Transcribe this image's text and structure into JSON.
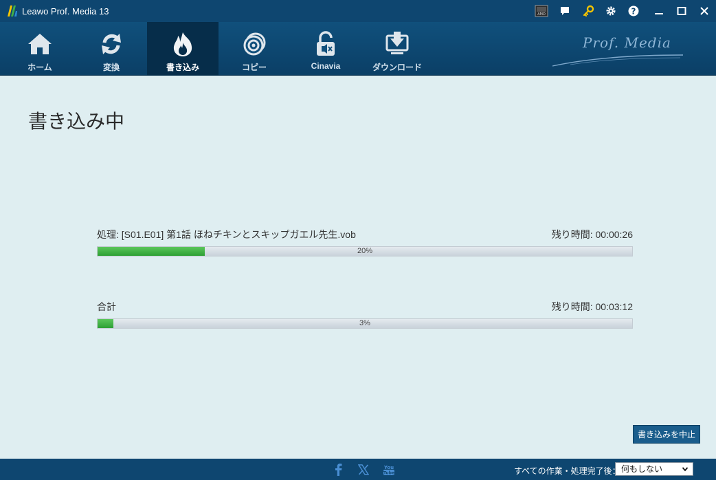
{
  "window": {
    "title": "Leawo Prof. Media 13"
  },
  "nav": {
    "items": [
      {
        "label": "ホーム",
        "icon": "home-icon"
      },
      {
        "label": "変換",
        "icon": "convert-icon"
      },
      {
        "label": "書き込み",
        "icon": "burn-icon",
        "active": true
      },
      {
        "label": "コピー",
        "icon": "copy-disc-icon"
      },
      {
        "label": "Cinavia",
        "icon": "cinavia-lock-icon"
      },
      {
        "label": "ダウンロード",
        "icon": "download-icon"
      }
    ],
    "brand": "Prof. Media"
  },
  "main": {
    "title": "書き込み中",
    "current": {
      "label": "処理: [S01.E01] 第1話 ほねチキンとスキップガエル先生.vob",
      "remaining": "残り時間: 00:00:26",
      "progress": 0.2,
      "percent_text": "20%"
    },
    "total": {
      "label": "合計",
      "remaining": "残り時間: 00:03:12",
      "progress": 0.03,
      "percent_text": "3%"
    },
    "stop_button": "書き込みを中止"
  },
  "footer": {
    "after_label": "すべての作業・処理完了後：",
    "after_value": "何もしない"
  },
  "colors": {
    "titlebar": "#0e4670",
    "accent": "#1a5d8c",
    "progress": "#3cb043",
    "background": "#dfeef1"
  }
}
